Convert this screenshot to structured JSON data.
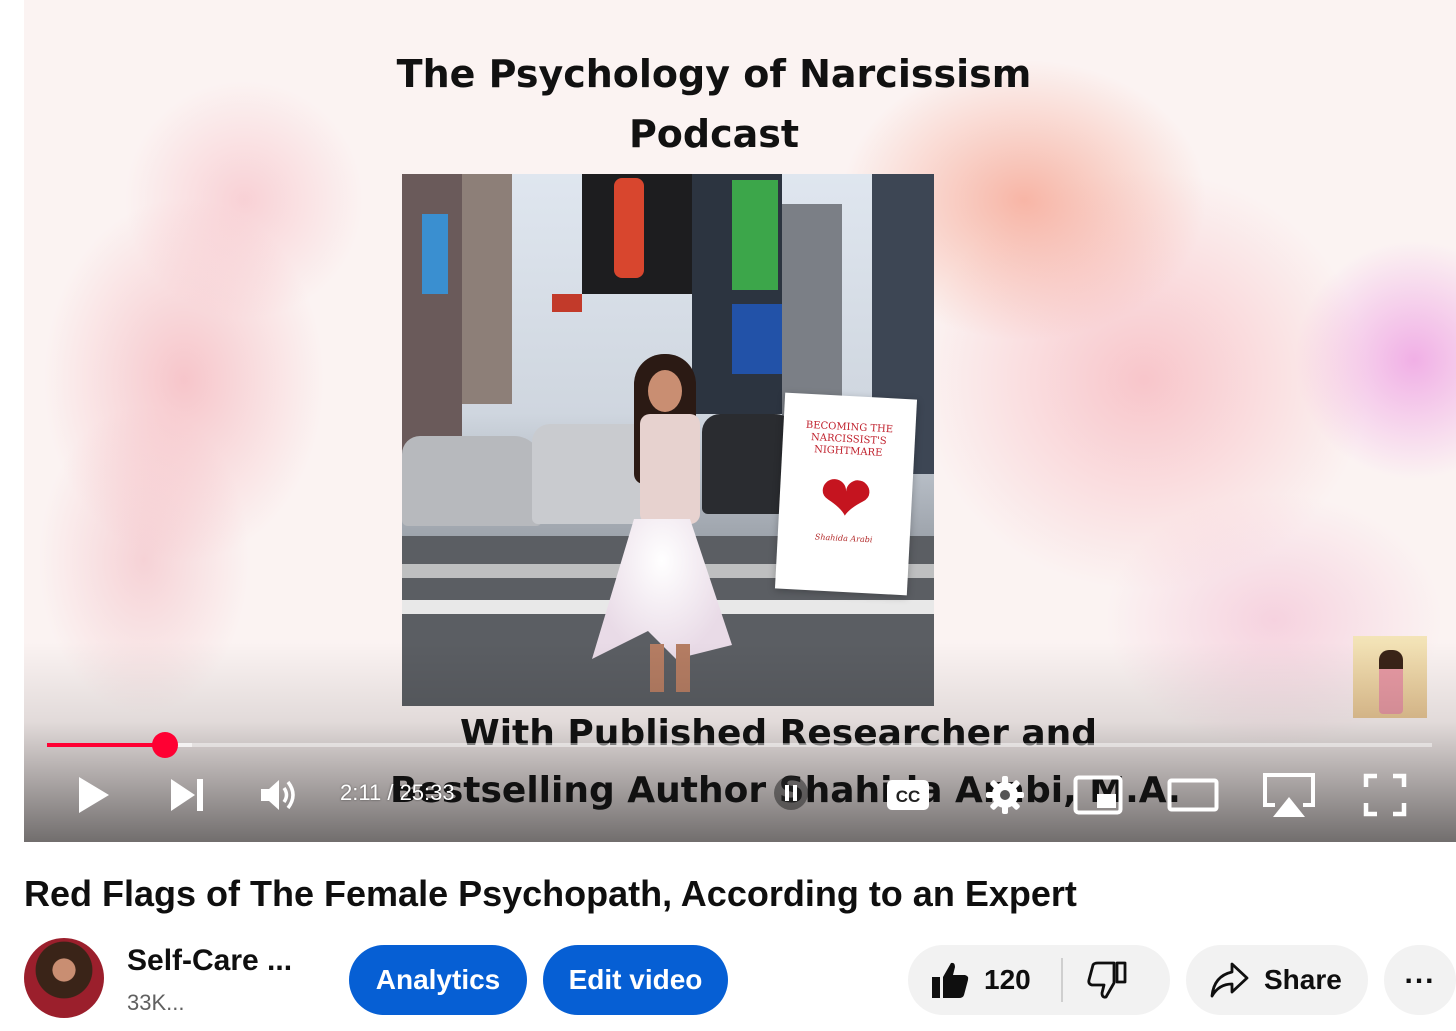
{
  "thumbnail": {
    "title_line1": "The Psychology of Narcissism",
    "title_line2": "Podcast",
    "subtitle_line1": "With Published Researcher and",
    "subtitle_line2": "Bestselling Author Shahida Arabi, M.A.",
    "book_title": "BECOMING THE NARCISSIST'S NIGHTMARE",
    "book_author": "Shahida Arabi"
  },
  "player": {
    "current_time": "2:11",
    "time_separator": "/",
    "duration": "25:33",
    "progress_played": 0.085,
    "progress_loaded": 0.105,
    "cc_label": "CC"
  },
  "video": {
    "title": "Red Flags of The Female Psychopath, According to an Expert"
  },
  "channel": {
    "name": "Self-Care ...",
    "subscribers": "33K..."
  },
  "actions": {
    "analytics_label": "Analytics",
    "edit_label": "Edit video",
    "like_count": "120",
    "share_label": "Share",
    "more_label": "..."
  },
  "colors": {
    "progress": "#ff0033",
    "primary_button": "#065fd4",
    "secondary_button": "#f2f2f2"
  },
  "icons": [
    "play-icon",
    "next-icon",
    "volume-icon",
    "pause-icon",
    "captions-icon",
    "settings-icon",
    "miniplayer-icon",
    "theater-icon",
    "airplay-icon",
    "fullscreen-icon",
    "thumbs-up-icon",
    "thumbs-down-icon",
    "share-arrow-icon",
    "more-icon"
  ]
}
